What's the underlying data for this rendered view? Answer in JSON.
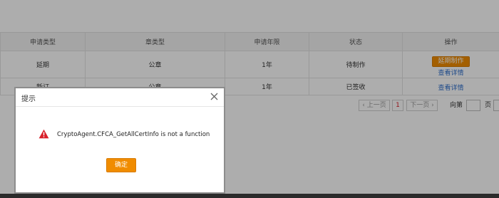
{
  "table": {
    "headers": [
      "申请类型",
      "章类型",
      "申请年限",
      "状态",
      "操作"
    ],
    "rows": [
      {
        "apply_type": "延期",
        "seal_type": "公章",
        "years": "1年",
        "status": "待制作",
        "action_button": "延期制作",
        "action_link": "查看详情"
      },
      {
        "apply_type": "新订",
        "seal_type": "公章",
        "years": "1年",
        "status": "已签收",
        "action_link": "查看详情"
      }
    ]
  },
  "pager": {
    "prev_label": "上一页",
    "current_page": "1",
    "next_label": "下一页",
    "goto_label": "向第",
    "page_unit": "页"
  },
  "dialog": {
    "title": "提示",
    "message": "CryptoAgent.CFCA_GetAllCertInfo is not a function",
    "ok_label": "确定",
    "icon": "warning-icon",
    "close_icon": "close-icon"
  },
  "colors": {
    "accent": "#f08c00",
    "link": "#2f6fcc",
    "warning": "#d9202a",
    "overlay": "rgba(0,0,0,0.32)"
  }
}
